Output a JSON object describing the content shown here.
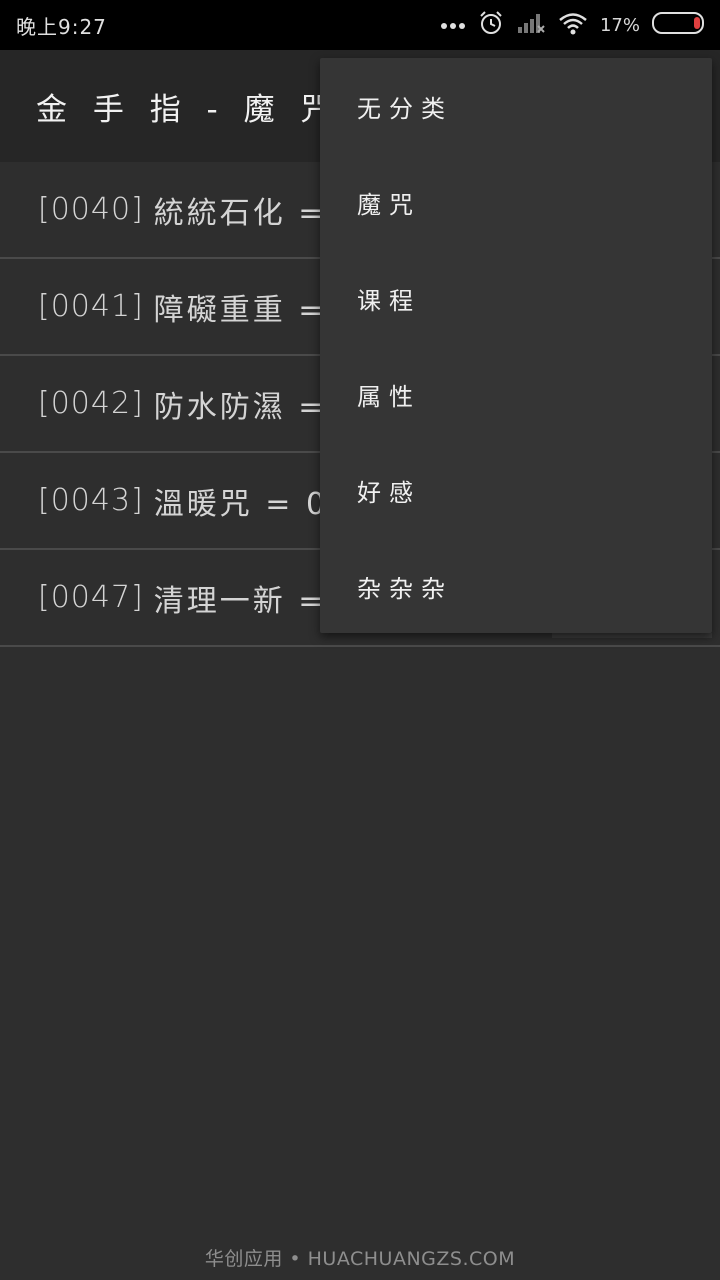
{
  "status_bar": {
    "time": "晚上9:27",
    "battery_pct": "17%",
    "icons": [
      "more-dots-icon",
      "alarm-icon",
      "signal-icon",
      "wifi-icon",
      "battery-icon"
    ],
    "battery_color": "#e04040"
  },
  "app_bar": {
    "title": "金 手 指 - 魔 咒"
  },
  "list": {
    "items": [
      {
        "code": "[0040]",
        "text": "統統石化 = "
      },
      {
        "code": "[0041]",
        "text": "障礙重重 = "
      },
      {
        "code": "[0042]",
        "text": "防水防濕 = "
      },
      {
        "code": "[0043]",
        "text": "溫暖咒 = 0"
      },
      {
        "code": "[0047]",
        "text": "清理一新 = "
      }
    ]
  },
  "menu": {
    "items": [
      "无分类",
      "魔咒",
      "课程",
      "属性",
      "好感",
      "杂杂杂"
    ]
  },
  "watermark": {
    "text": "华创应用 • HUACHUANGZS.COM"
  },
  "colors": {
    "background": "#2e2e2e",
    "app_bar": "#262626",
    "menu": "#353535",
    "divider": "#4a4a4a"
  }
}
